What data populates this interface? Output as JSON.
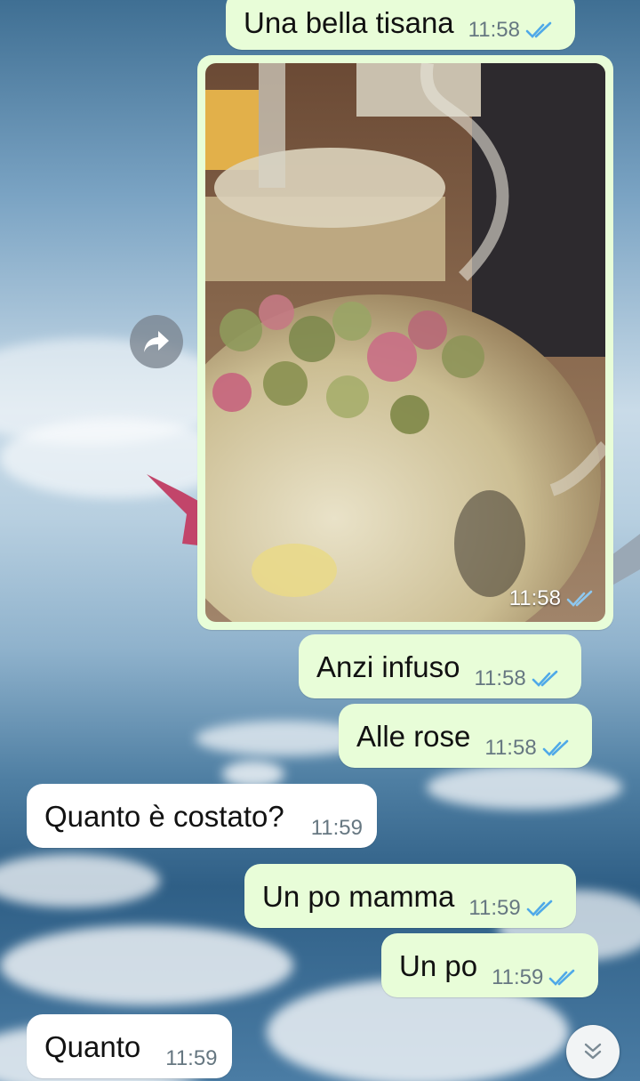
{
  "colors": {
    "outgoing_bubble": "#e8fdd8",
    "incoming_bubble": "#ffffff",
    "read_ticks": "#4fa9e8"
  },
  "messages": [
    {
      "text": "Una bella tisana",
      "time": "11:58",
      "direction": "out",
      "status": "read"
    },
    {
      "type": "image",
      "time": "11:58",
      "direction": "out",
      "status": "read"
    },
    {
      "text": "Anzi infuso",
      "time": "11:58",
      "direction": "out",
      "status": "read"
    },
    {
      "text": "Alle rose",
      "time": "11:58",
      "direction": "out",
      "status": "read"
    },
    {
      "text": "Quanto è costato?",
      "time": "11:59",
      "direction": "in"
    },
    {
      "text": "Un po mamma",
      "time": "11:59",
      "direction": "out",
      "status": "read"
    },
    {
      "text": "Un po",
      "time": "11:59",
      "direction": "out",
      "status": "read"
    },
    {
      "text": "Quanto",
      "time": "11:59",
      "direction": "in"
    }
  ],
  "icons": {
    "forward": "forward-arrow-icon",
    "scroll_down": "double-chevron-down-icon",
    "read": "double-check-icon"
  }
}
